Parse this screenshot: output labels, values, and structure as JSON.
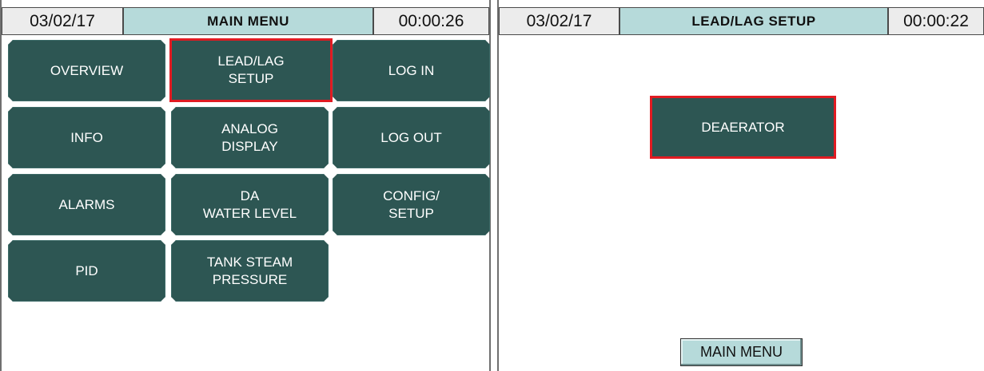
{
  "left_screen": {
    "header": {
      "date": "03/02/17",
      "title": "MAIN MENU",
      "time": "00:00:26"
    },
    "buttons": [
      {
        "label": "OVERVIEW"
      },
      {
        "label": "LEAD/LAG\nSETUP",
        "selected": true
      },
      {
        "label": "LOG IN"
      },
      {
        "label": "INFO"
      },
      {
        "label": "ANALOG\nDISPLAY"
      },
      {
        "label": "LOG OUT"
      },
      {
        "label": "ALARMS"
      },
      {
        "label": "DA\nWATER LEVEL"
      },
      {
        "label": "CONFIG/\nSETUP"
      },
      {
        "label": "PID"
      },
      {
        "label": "TANK STEAM\nPRESSURE"
      }
    ]
  },
  "right_screen": {
    "header": {
      "date": "03/02/17",
      "title": "LEAD/LAG SETUP",
      "time": "00:00:22"
    },
    "deaerator_button": {
      "label": "DEAERATOR",
      "selected": true
    },
    "main_menu_button": {
      "label": "MAIN MENU"
    }
  },
  "colors": {
    "button_fill": "#2d5653",
    "header_title_fill": "#b6dada",
    "selection_outline": "#e11b22"
  }
}
